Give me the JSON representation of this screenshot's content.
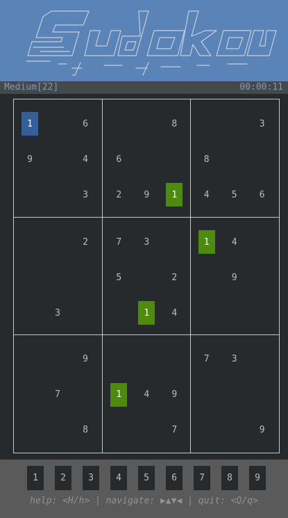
{
  "title_art_text": "Sudoku",
  "status": {
    "difficulty": "Medium[22]",
    "timer": "00:00:11"
  },
  "board": {
    "rows": [
      [
        "1",
        "",
        "6",
        "",
        "",
        "8",
        "",
        "",
        "3"
      ],
      [
        "9",
        "",
        "4",
        "6",
        "",
        "",
        "8",
        "",
        ""
      ],
      [
        "",
        "",
        "3",
        "2",
        "9",
        "1",
        "4",
        "5",
        "6"
      ],
      [
        "",
        "",
        "2",
        "7",
        "3",
        "",
        "1",
        "4",
        ""
      ],
      [
        "",
        "",
        "",
        "5",
        "",
        "2",
        "",
        "9",
        ""
      ],
      [
        "",
        "3",
        "",
        "",
        "1",
        "4",
        "",
        "",
        ""
      ],
      [
        "",
        "",
        "9",
        "",
        "",
        "",
        "7",
        "3",
        ""
      ],
      [
        "",
        "7",
        "",
        "1",
        "4",
        "9",
        "",
        "",
        ""
      ],
      [
        "",
        "",
        "8",
        "",
        "",
        "7",
        "",
        "",
        "9"
      ]
    ],
    "selected_cell": [
      0,
      0
    ],
    "highlighted_digit": "1"
  },
  "number_buttons": [
    "1",
    "2",
    "3",
    "4",
    "5",
    "6",
    "7",
    "8",
    "9"
  ],
  "help_text": "help: <H/h> | navigate: ▶▲▼◀ | quit: <Q/q>",
  "colors": {
    "header_bg": "#5a84b8",
    "selected_bg": "#335f9a",
    "highlight_bg": "#4f8a10",
    "board_bg": "#262a2c"
  }
}
